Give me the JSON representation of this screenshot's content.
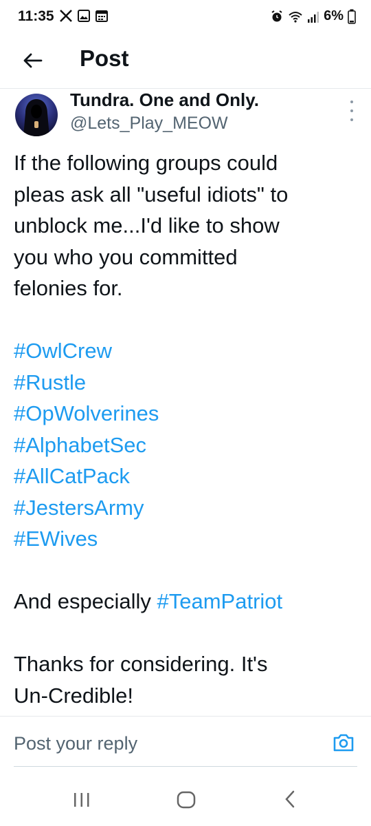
{
  "status_bar": {
    "time": "11:35",
    "battery_text": "6%",
    "icons": [
      "x-logo-icon",
      "image-icon",
      "calendar-icon",
      "alarm-icon",
      "wifi-icon",
      "signal-icon",
      "battery-icon"
    ]
  },
  "header": {
    "title": "Post",
    "back_icon": "arrow-left-icon"
  },
  "post": {
    "display_name": "Tundra. One and Only.",
    "handle": "@Lets_Play_MEOW",
    "text_lines": [
      "If the following groups could",
      "pleas ask all \"useful idiots\" to",
      "unblock me...I'd like to show",
      "you who you committed",
      "felonies for."
    ],
    "hashtags": [
      "#OwlCrew",
      "#Rustle",
      "#OpWolverines",
      "#AlphabetSec",
      "#AllCatPack",
      "#JestersArmy",
      "#EWives"
    ],
    "especially_prefix": "And especially ",
    "especially_tag": "#TeamPatriot",
    "closing_lines": [
      "Thanks for considering. It's",
      "Un-Credible!"
    ]
  },
  "reply": {
    "placeholder": "Post your reply",
    "camera_icon": "camera-icon"
  },
  "colors": {
    "hashtag": "#1d9bf0",
    "text": "#0f1419",
    "secondary": "#536471"
  },
  "nav_bar": {
    "icons": [
      "recents-icon",
      "home-icon",
      "back-icon"
    ]
  }
}
